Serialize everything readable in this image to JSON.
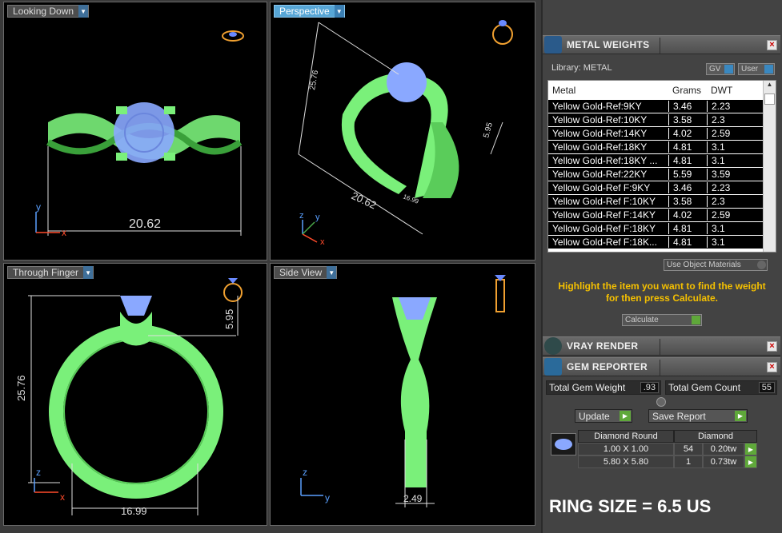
{
  "viewports": {
    "top_left": {
      "label": "Looking Down",
      "dimension": "20.62",
      "axis_y": "y",
      "axis_x": "x"
    },
    "top_right": {
      "label": "Perspective",
      "dim_height": "25.76",
      "dim_width": "20.62",
      "dim_small": "5.95",
      "dim_mini": "16.99",
      "axis_z": "z",
      "axis_y": "y",
      "axis_x": "x"
    },
    "bottom_left": {
      "label": "Through Finger",
      "dim_height": "25.76",
      "dim_top": "5.95",
      "dim_width": "16.99",
      "axis_z": "z",
      "axis_x": "x"
    },
    "bottom_right": {
      "label": "Side View",
      "dim_width": "2.49",
      "axis_z": "z",
      "axis_y": "y"
    }
  },
  "metal_weights": {
    "title": "METAL WEIGHTS",
    "library_label": "Library: METAL",
    "gv_label": "GV",
    "user_label": "User",
    "columns": [
      "Metal",
      "Grams",
      "DWT"
    ],
    "rows": [
      {
        "metal": "Yellow Gold-Ref:9KY",
        "grams": "3.46",
        "dwt": "2.23"
      },
      {
        "metal": "Yellow Gold-Ref:10KY",
        "grams": "3.58",
        "dwt": "2.3"
      },
      {
        "metal": "Yellow Gold-Ref:14KY",
        "grams": "4.02",
        "dwt": "2.59"
      },
      {
        "metal": "Yellow Gold-Ref:18KY",
        "grams": "4.81",
        "dwt": "3.1"
      },
      {
        "metal": "Yellow Gold-Ref:18KY ...",
        "grams": "4.81",
        "dwt": "3.1"
      },
      {
        "metal": "Yellow Gold-Ref:22KY",
        "grams": "5.59",
        "dwt": "3.59"
      },
      {
        "metal": "Yellow Gold-Ref F:9KY",
        "grams": "3.46",
        "dwt": "2.23"
      },
      {
        "metal": "Yellow Gold-Ref F:10KY",
        "grams": "3.58",
        "dwt": "2.3"
      },
      {
        "metal": "Yellow Gold-Ref F:14KY",
        "grams": "4.02",
        "dwt": "2.59"
      },
      {
        "metal": "Yellow Gold-Ref F:18KY",
        "grams": "4.81",
        "dwt": "3.1"
      },
      {
        "metal": "Yellow Gold-Ref F:18K...",
        "grams": "4.81",
        "dwt": "3.1"
      }
    ],
    "use_object_materials": "Use Object Materials",
    "notice": "Highlight the item you want to find the weight for then press Calculate.",
    "calculate_label": "Calculate"
  },
  "vray": {
    "title": "VRAY RENDER"
  },
  "gem_reporter": {
    "title": "GEM REPORTER",
    "total_weight_label": "Total Gem Weight",
    "total_weight_value": ".93",
    "total_count_label": "Total Gem Count",
    "total_count_value": "55",
    "update_label": "Update",
    "save_label": "Save Report",
    "table_headers": [
      "Diamond Round",
      "Diamond"
    ],
    "table_rows": [
      {
        "size": "1.00 X 1.00",
        "count": "54",
        "weight": "0.20tw"
      },
      {
        "size": "5.80 X 5.80",
        "count": "1",
        "weight": "0.73tw"
      }
    ]
  },
  "ring_size": "RING SIZE = 6.5 US",
  "colors": {
    "ring": "#7af07a",
    "gem": "#8aa8ff",
    "dim": "#e0e0e0",
    "accent": "#57a6d6",
    "notice": "#f5c000"
  }
}
